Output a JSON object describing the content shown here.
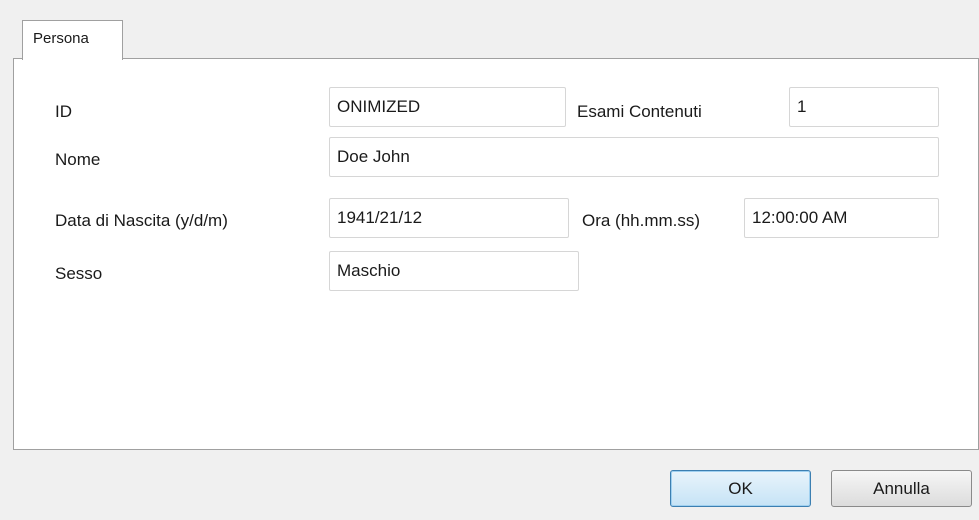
{
  "tabs": {
    "persona_label": "Persona"
  },
  "fields": {
    "id": {
      "label": "ID",
      "value": "ONIMIZED"
    },
    "esami_contenuti": {
      "label": "Esami Contenuti",
      "value": "1"
    },
    "nome": {
      "label": "Nome",
      "value": "Doe John"
    },
    "data_nascita": {
      "label": "Data di Nascita (y/d/m)",
      "value": "1941/21/12"
    },
    "ora": {
      "label": "Ora (hh.mm.ss)",
      "value": "12:00:00 AM"
    },
    "sesso": {
      "label": "Sesso",
      "value": "Maschio"
    }
  },
  "buttons": {
    "ok_label": "OK",
    "cancel_label": "Annulla"
  }
}
